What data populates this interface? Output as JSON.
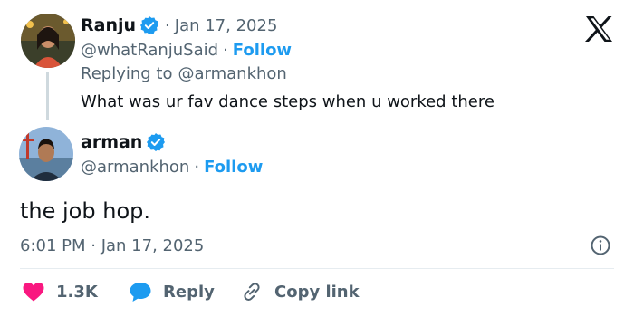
{
  "parent": {
    "name": "Ranju",
    "separator": "·",
    "date": "Jan 17, 2025",
    "handle": "@whatRanjuSaid",
    "follow_label": "Follow",
    "replying_prefix": "Replying to",
    "replying_to": "@armankhon",
    "text": "What was ur fav dance steps when u worked there"
  },
  "reply": {
    "name": "arman",
    "handle": "@armankhon",
    "separator": "·",
    "follow_label": "Follow",
    "text": "the job hop.",
    "timestamp": "6:01 PM · Jan 17, 2025"
  },
  "actions": {
    "likes": "1.3K",
    "reply_label": "Reply",
    "copy_label": "Copy link"
  },
  "colors": {
    "accent": "#1d9bf0",
    "like": "#f91880",
    "muted": "#536471",
    "text": "#0f1419"
  },
  "icons": [
    "verified-badge-icon",
    "x-logo-icon",
    "info-icon",
    "heart-icon",
    "reply-bubble-icon",
    "link-icon"
  ]
}
